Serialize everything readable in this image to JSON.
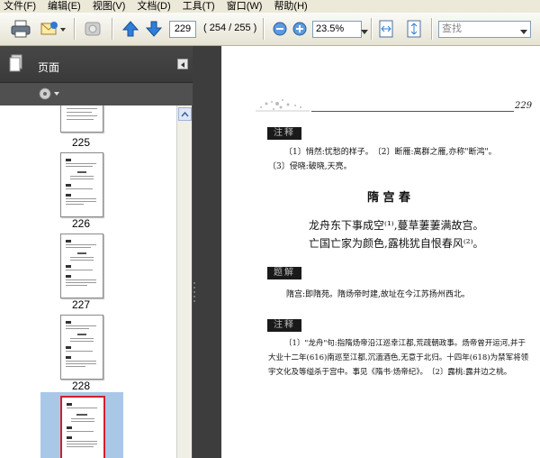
{
  "menubar": {
    "items": [
      "文件(F)",
      "编辑(E)",
      "视图(V)",
      "文档(D)",
      "工具(T)",
      "窗口(W)",
      "帮助(H)"
    ]
  },
  "toolbar": {
    "page_number": "229",
    "page_count": "( 254 / 255 )",
    "zoom": "23.5%",
    "search_placeholder": "查找"
  },
  "sidebar": {
    "title": "页面",
    "thumbnails": [
      {
        "label": "225"
      },
      {
        "label": "226"
      },
      {
        "label": "227"
      },
      {
        "label": "228"
      },
      {
        "label": ""
      }
    ]
  },
  "document": {
    "page_number": "229",
    "section1_mark": "注释",
    "notes1_line1": "〔1〕悄然:忧愁的样子。　〔2〕断雁:离群之雁,亦称\"断鸿\"。",
    "notes1_line2": "〔3〕侵晓:破晓,天亮。",
    "poem_title": "隋 宫 春",
    "poem_line1": "龙舟东下事成空⁽¹⁾,蔓草萋萋满故宫。",
    "poem_line2": "亡国亡家为颜色,露桃犹自恨春风⁽²⁾。",
    "section2_mark": "题解",
    "explanation": "隋宫:即隋苑。隋炀帝时建,故址在今江苏扬州西北。",
    "section3_mark": "注释",
    "notes2_line1": "〔1〕\"龙舟\"句:指隋炀帝沿江巡幸江都,荒疏朝政事。炀帝曾开运河,并于",
    "notes2_line2": "大业十二年(616)南巡至江都,沉湎酒色,无意于北归。十四年(618)为禁军将领",
    "notes2_line3": "宇文化及等缢杀于宫中。事见《隋书·炀帝纪》。　〔2〕露桃:露井边之桃。"
  },
  "colors": {
    "menubar_bg": "#ece9d8",
    "panel_bg": "#4f4f4f",
    "selected_thumb_border": "#d0202a",
    "selected_thumb_bg": "#a9c8e8"
  }
}
